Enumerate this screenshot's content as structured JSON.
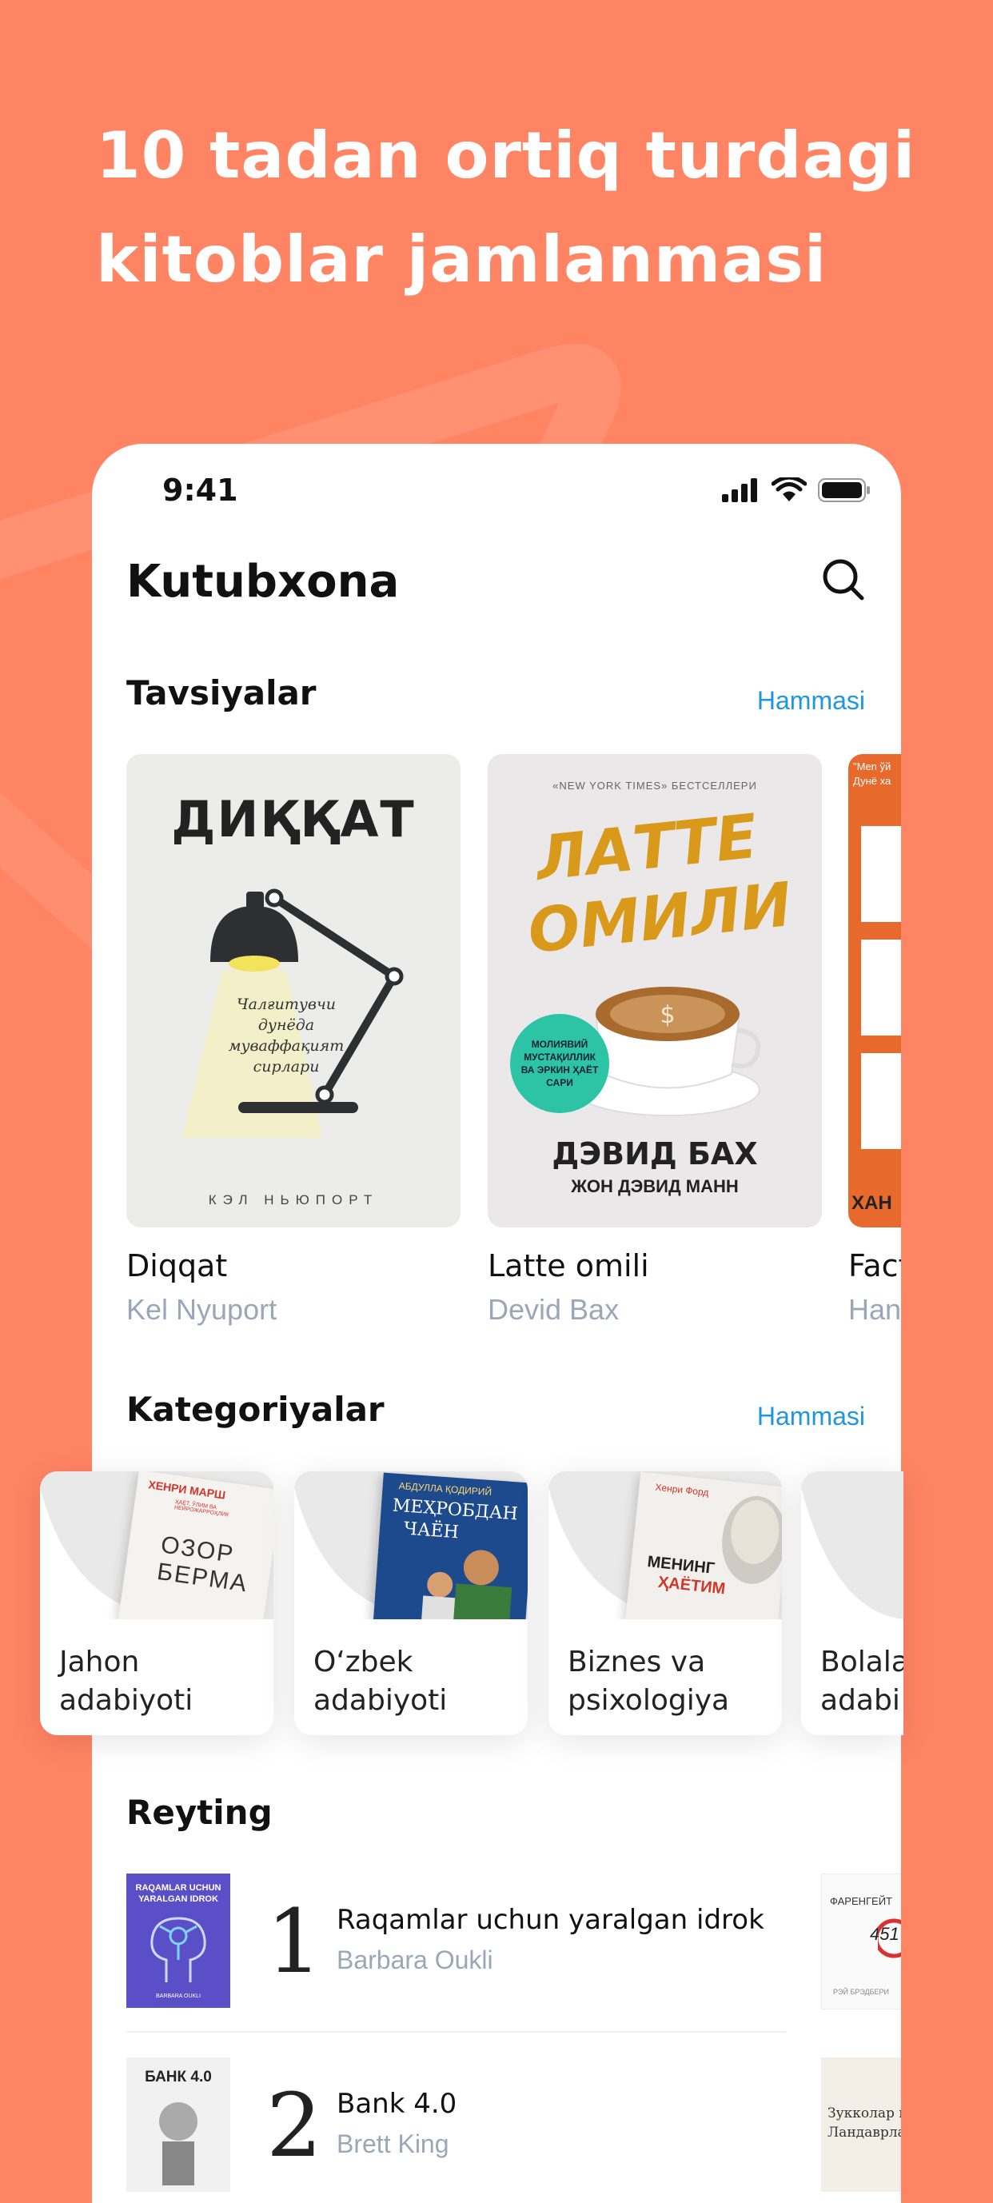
{
  "headline": {
    "line1": "10 tadan ortiq turdagi",
    "line2": "kitoblar jamlanmasi"
  },
  "status_bar": {
    "time": "9:41"
  },
  "header": {
    "title": "Kutubxona",
    "search_icon": "search-icon"
  },
  "recommendations": {
    "title": "Tavsiyalar",
    "see_all": "Hammasi",
    "books": [
      {
        "title": "Diqqat",
        "author": "Kel Nyuport",
        "cover_heading": "ДИҚҚАТ",
        "cover_lines": [
          "Чалғитувчи",
          "дунёда",
          "муваффақият",
          "сирлари"
        ],
        "cover_author": "КЭЛ НЬЮПОРТ"
      },
      {
        "title": "Latte omili",
        "author": "Devid Bax",
        "cover_top": "«NEW YORK TIMES» БЕСТСЕЛЛЕРИ",
        "cover_heading_1": "ЛАТТЕ",
        "cover_heading_2": "ОМИЛИ",
        "cover_badge": [
          "МОЛИЯВИЙ",
          "МУСТАҚИЛЛИК",
          "ВА ЭРКИН ҲАЁТ",
          "САРИ"
        ],
        "cover_author_1": "ДЭВИД БАХ",
        "cover_author_2": "ЖОН ДЭВИД МАНН"
      },
      {
        "title": "Fact",
        "author": "Han",
        "cover_top": "\"Men ўй",
        "cover_top_2": "Дунё ха",
        "cover_bottom": "ХАН"
      }
    ]
  },
  "categories": {
    "title": "Kategoriyalar",
    "see_all": "Hammasi",
    "items": [
      {
        "line1": "Jahon",
        "line2": "adabiyoti",
        "cover_author": "ХЕНРИ МАРШ",
        "cover_title_1": "ОЗОР",
        "cover_title_2": "БЕРМА",
        "cover_sub": "ҲАЁТ, ЎЛИМ ВА НЕЙРОЖАРРОҲЛИК"
      },
      {
        "line1": "O‘zbek",
        "line2": "adabiyoti",
        "cover_author": "АБДУЛЛА ҚОДИРИЙ",
        "cover_title_1": "МЕҲРОБДАН",
        "cover_title_2": "ЧАЁН"
      },
      {
        "line1": "Biznes va",
        "line2": "psixologiya",
        "cover_author": "Хенри Форд",
        "cover_title_1": "МЕНИНГ",
        "cover_title_2": "ҲАЁТИМ"
      },
      {
        "line1": "Bolala",
        "line2": "adabi"
      }
    ]
  },
  "rating": {
    "title": "Reyting",
    "items": [
      {
        "rank": "1",
        "title": "Raqamlar uchun yaralgan idrok",
        "author": "Barbara Oukli",
        "cover_title_1": "RAQAMLAR UCHUN",
        "cover_title_2": "YARALGAN IDROK",
        "cover_author": "BARBARA OUKLI",
        "side_cover_1": "ФАРЕНГЕЙТ",
        "side_cover_2": "451",
        "side_cover_3": "РЭЙ БРЭДБЕРИ"
      },
      {
        "rank": "2",
        "title": "Bank 4.0",
        "author": "Brett King",
        "cover_title_1": "БАНК 4.0",
        "side_cover_1": "Зукколар в",
        "side_cover_2": "Ландаврла"
      }
    ]
  },
  "colors": {
    "background": "#ff8463",
    "accent": "#2196e0",
    "muted": "#9aa7b8"
  }
}
